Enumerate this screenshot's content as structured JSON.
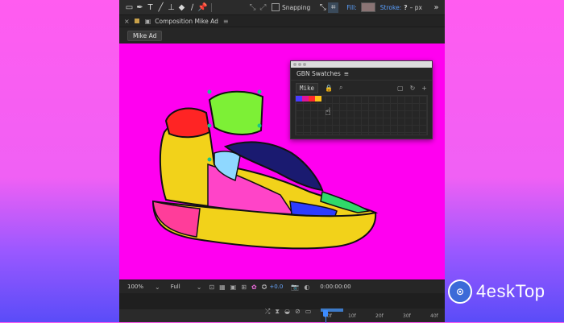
{
  "toolbar": {
    "icons": [
      "select-icon",
      "pen-icon",
      "type-icon",
      "brush-icon",
      "clone-stamp-icon",
      "eraser-icon",
      "roto-brush-icon",
      "puppet-pin-icon"
    ],
    "snapping_label": "Snapping",
    "fill_label": "Fill:",
    "stroke_label": "Stroke:",
    "stroke_value": "?",
    "stroke_unit": "– px",
    "fill_color": "#8a7474"
  },
  "composition": {
    "tab_title": "Composition Mike Ad",
    "subtab_label": "Mike Ad",
    "background_color": "#ff00f0"
  },
  "swatch_panel": {
    "title": "GBN Swatches",
    "set_name": "Mike",
    "swatches": [
      "#4a3cff",
      "#e0139a",
      "#ff2a2a",
      "#ffc21a"
    ]
  },
  "viewer": {
    "zoom": "100%",
    "resolution": "Full",
    "exposure": "+0.0",
    "timecode": "0:00:00:00"
  },
  "timeline": {
    "ticks": [
      "00f",
      "10f",
      "20f",
      "30f",
      "40f"
    ]
  },
  "watermark": {
    "brand": "4eskTop"
  }
}
